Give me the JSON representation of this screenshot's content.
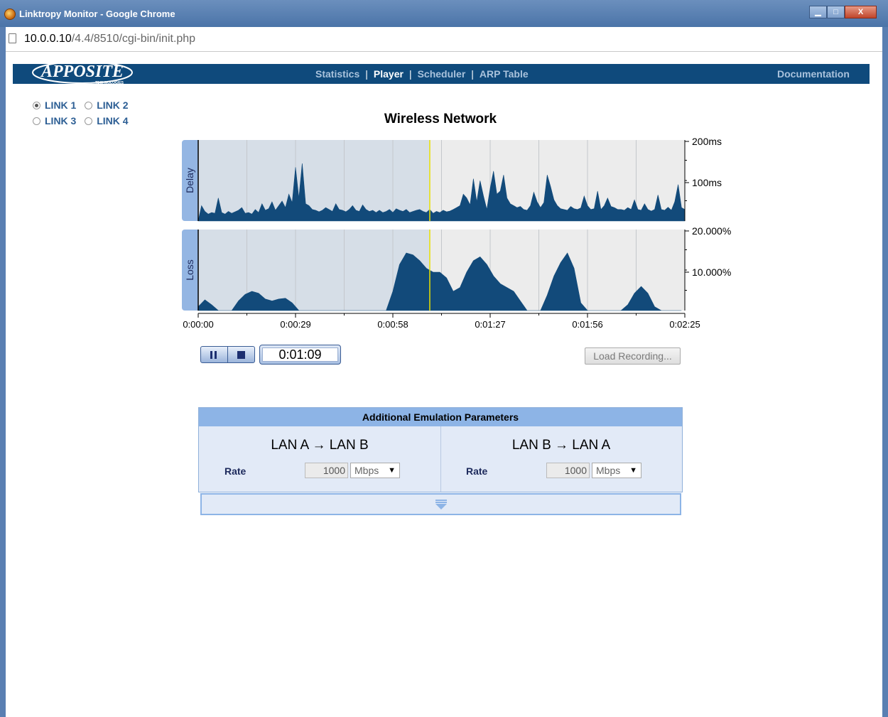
{
  "window": {
    "title": "Linktropy Monitor - Google Chrome",
    "btn_min": "▁",
    "btn_max": "□",
    "btn_close": "X"
  },
  "address": {
    "host": "10.0.0.10",
    "path": "/4.4/8510/cgi-bin/init.php"
  },
  "logo": {
    "name": "APPOSITE",
    "sub": "TECHNOLOGIES"
  },
  "nav": {
    "items": [
      "Statistics",
      "Player",
      "Scheduler",
      "ARP Table"
    ],
    "active": "Player",
    "separator": "|",
    "documentation": "Documentation"
  },
  "links": [
    {
      "label": "LINK 1",
      "selected": true
    },
    {
      "label": "LINK 2",
      "selected": false
    },
    {
      "label": "LINK 3",
      "selected": false
    },
    {
      "label": "LINK 4",
      "selected": false
    }
  ],
  "page_title": "Wireless Network",
  "player": {
    "time": "0:01:09",
    "load_label": "Load Recording..."
  },
  "params": {
    "header": "Additional Emulation Parameters",
    "left": {
      "direction": "LAN A → LAN B",
      "rate_label": "Rate",
      "rate_value": "1000",
      "unit": "Mbps",
      "arrow": "▼"
    },
    "right": {
      "direction": "LAN B → LAN A",
      "rate_label": "Rate",
      "rate_value": "1000",
      "unit": "Mbps",
      "arrow": "▼"
    }
  },
  "colors": {
    "header_bg": "#0f4a7c",
    "fill": "#124a7a",
    "played_bg": "#d6dee7",
    "unplayed_bg": "#ececec",
    "tab": "#94b6e3",
    "cursor": "#e8e000"
  },
  "chart_data": [
    {
      "type": "area",
      "title": "Delay",
      "ylabel": "Delay",
      "yticks": [
        "200ms",
        "100ms"
      ],
      "ylim": [
        0,
        200
      ],
      "xlim": [
        0,
        145
      ],
      "xticks": [
        "0:00:00",
        "0:00:29",
        "0:00:58",
        "0:01:27",
        "0:01:56",
        "0:02:25"
      ],
      "cursor": 69,
      "x": [
        0,
        1,
        2,
        3,
        4,
        5,
        6,
        7,
        8,
        9,
        10,
        11,
        12,
        13,
        14,
        15,
        16,
        17,
        18,
        19,
        20,
        21,
        22,
        23,
        24,
        25,
        26,
        27,
        28,
        29,
        30,
        31,
        32,
        33,
        34,
        35,
        36,
        37,
        38,
        39,
        40,
        41,
        42,
        43,
        44,
        45,
        46,
        47,
        48,
        49,
        50,
        51,
        52,
        53,
        54,
        55,
        56,
        57,
        58,
        59,
        60,
        61,
        62,
        63,
        64,
        65,
        66,
        67,
        68,
        69,
        70,
        71,
        72,
        73,
        74,
        75,
        76,
        77,
        78,
        79,
        80,
        81,
        82,
        83,
        84,
        85,
        86,
        87,
        88,
        89,
        90,
        91,
        92,
        93,
        94,
        95,
        96,
        97,
        98,
        99,
        100,
        101,
        102,
        103,
        104,
        105,
        106,
        107,
        108,
        109,
        110,
        111,
        112,
        113,
        114,
        115,
        116,
        117,
        118,
        119,
        120,
        121,
        122,
        123,
        124,
        125,
        126,
        127,
        128,
        129,
        130,
        131,
        132,
        133,
        134,
        135,
        136,
        137,
        138,
        139,
        140,
        141,
        142,
        143,
        144,
        145
      ],
      "y": [
        0,
        40,
        25,
        18,
        22,
        20,
        60,
        22,
        18,
        25,
        20,
        24,
        28,
        35,
        20,
        22,
        18,
        30,
        22,
        45,
        28,
        32,
        50,
        28,
        40,
        52,
        35,
        70,
        48,
        140,
        60,
        150,
        45,
        40,
        30,
        28,
        24,
        28,
        35,
        30,
        25,
        45,
        30,
        28,
        24,
        30,
        40,
        28,
        25,
        42,
        30,
        25,
        28,
        22,
        28,
        22,
        25,
        30,
        22,
        32,
        28,
        25,
        30,
        22,
        25,
        28,
        30,
        25,
        22,
        30,
        20,
        25,
        22,
        28,
        24,
        26,
        30,
        35,
        40,
        70,
        60,
        42,
        110,
        50,
        105,
        65,
        30,
        85,
        130,
        70,
        78,
        120,
        60,
        45,
        40,
        35,
        38,
        30,
        28,
        40,
        75,
        50,
        35,
        48,
        120,
        90,
        55,
        40,
        32,
        30,
        28,
        38,
        32,
        30,
        34,
        65,
        40,
        30,
        32,
        78,
        30,
        40,
        60,
        38,
        35,
        30,
        30,
        28,
        35,
        30,
        55,
        30,
        28,
        45,
        30,
        26,
        30,
        68,
        30,
        28,
        36,
        28,
        50,
        95,
        35,
        30
      ],
      "points": 146
    },
    {
      "type": "area",
      "title": "Loss",
      "ylabel": "Loss",
      "yticks": [
        "20.000%",
        "10.000%"
      ],
      "ylim": [
        0,
        20
      ],
      "xlim": [
        0,
        145
      ],
      "xticks": [
        "0:00:00",
        "0:00:29",
        "0:00:58",
        "0:01:27",
        "0:01:56",
        "0:02:25"
      ],
      "cursor": 69,
      "x": [
        0,
        2,
        4,
        6,
        8,
        10,
        12,
        14,
        16,
        18,
        20,
        22,
        24,
        26,
        28,
        30,
        32,
        34,
        36,
        38,
        40,
        42,
        44,
        46,
        48,
        50,
        52,
        54,
        56,
        58,
        60,
        62,
        64,
        66,
        68,
        70,
        72,
        74,
        76,
        78,
        80,
        82,
        84,
        86,
        88,
        90,
        92,
        94,
        96,
        98,
        100,
        102,
        104,
        106,
        108,
        110,
        112,
        114,
        116,
        118,
        120,
        122,
        124,
        126,
        128,
        130,
        132,
        134,
        136,
        138,
        140,
        142,
        144
      ],
      "y": [
        1,
        2.8,
        1.5,
        0,
        0,
        0,
        2.5,
        4.2,
        5,
        4.5,
        3,
        2.5,
        3,
        3.2,
        2,
        0,
        0,
        0,
        0,
        0,
        0,
        0,
        0,
        0,
        0,
        0,
        0,
        0,
        0,
        5,
        12,
        15,
        14.5,
        13,
        11,
        10,
        10,
        8.5,
        5,
        6,
        10,
        13,
        14,
        12,
        9,
        7,
        6,
        5,
        2.5,
        0,
        0,
        0,
        4,
        9,
        12.5,
        15,
        11,
        2,
        0,
        0,
        0,
        0,
        0,
        0,
        1.5,
        4.5,
        6.3,
        4.5,
        1,
        0,
        0,
        0,
        0
      ]
    }
  ]
}
